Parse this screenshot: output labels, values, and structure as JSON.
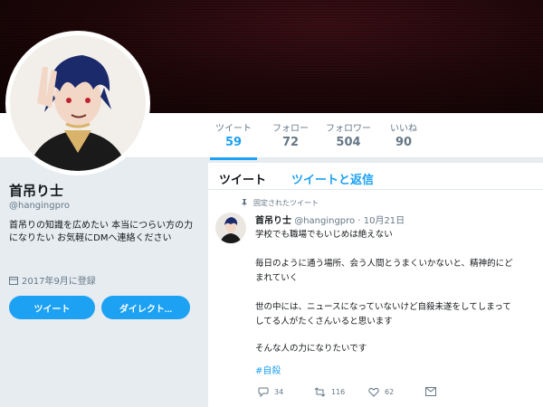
{
  "nav": {
    "stats": [
      {
        "label": "ツイート",
        "value": "59"
      },
      {
        "label": "フォロー",
        "value": "72"
      },
      {
        "label": "フォロワー",
        "value": "504"
      },
      {
        "label": "いいね",
        "value": "90"
      }
    ]
  },
  "profile": {
    "name": "首吊り士",
    "handle": "@hangingpro",
    "bio": "首吊りの知識を広めたい 本当につらい方の力になりたい お気軽にDMへ連絡ください",
    "joined": "2017年9月に登録",
    "tweet_button": "ツイート",
    "dm_button": "ダイレクト..."
  },
  "timeline": {
    "tabs": [
      "ツイート",
      "ツイートと返信"
    ],
    "pinned_label": "固定されたツイート",
    "tweet": {
      "name": "首吊り士",
      "handle": "@hangingpro",
      "date": "· 10月21日",
      "lines": [
        "学校でも職場でもいじめは絶えない",
        "毎日のように通う場所、会う人間とうまくいかないと、精神的にど",
        "まれていく",
        "世の中には、ニュースになっていないけど自殺未遂をしてしまって",
        "してる人がたくさんいると思います",
        "そんな人の力になりたいです"
      ],
      "hashtag": "#自殺",
      "replies": "34",
      "retweets": "116",
      "likes": "62"
    }
  },
  "colors": {
    "accent": "#1da1f2",
    "background": "#e6ecf0",
    "banner": "#1e0709"
  },
  "icons": [
    "pin-icon",
    "calendar-icon",
    "reply-icon",
    "retweet-icon",
    "like-icon",
    "message-icon"
  ]
}
